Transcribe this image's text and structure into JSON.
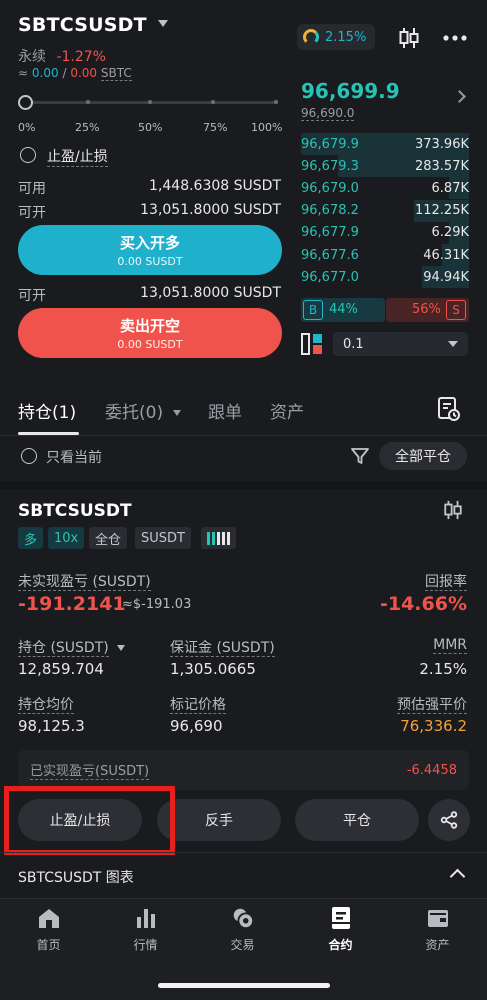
{
  "header": {
    "pair": "SBTCSUSDT",
    "contract_type": "永续",
    "change": "-1.27%",
    "available_prefix": "≈",
    "available_value": "0.00",
    "available_sep": "/",
    "available_value2": "0.00",
    "available_unit": "SBTC",
    "funding_rate": "2.15%"
  },
  "slider": {
    "labels": [
      "0%",
      "25%",
      "50%",
      "75%",
      "100%"
    ],
    "value_percent": 0
  },
  "order_form": {
    "tpsl_label": "止盈/止损",
    "available_label": "可用",
    "available_value": "1,448.6308 SUSDT",
    "open_label": "可开",
    "open_value": "13,051.8000 SUSDT",
    "buy_title": "买入开多",
    "buy_sub": "0.00 SUSDT",
    "open_label2": "可开",
    "open_value2": "13,051.8000 SUSDT",
    "sell_title": "卖出开空",
    "sell_sub": "0.00 SUSDT"
  },
  "orderbook": {
    "last_price": "96,699.9",
    "mark_price": "96,690.0",
    "bids": [
      {
        "price": "96,679.9",
        "size": "373.96K",
        "depth": 1.0
      },
      {
        "price": "96,679.3",
        "size": "283.57K",
        "depth": 0.78
      },
      {
        "price": "96,679.0",
        "size": "6.87K",
        "depth": 0.12
      },
      {
        "price": "96,678.2",
        "size": "112.25K",
        "depth": 0.33
      },
      {
        "price": "96,677.9",
        "size": "6.29K",
        "depth": 0.12
      },
      {
        "price": "96,677.6",
        "size": "46.31K",
        "depth": 0.16
      },
      {
        "price": "96,677.0",
        "size": "94.94K",
        "depth": 0.28
      }
    ],
    "buy_tag": "B",
    "buy_ratio": "44%",
    "sell_ratio": "56%",
    "sell_tag": "S",
    "depth_step": "0.1"
  },
  "tabs": [
    {
      "label": "持仓(1)"
    },
    {
      "label": "委托(0)"
    },
    {
      "label": "跟单"
    },
    {
      "label": "资产"
    }
  ],
  "filters": {
    "current_only": "只看当前",
    "close_all": "全部平仓"
  },
  "position": {
    "symbol": "SBTCSUSDT",
    "side": "多",
    "leverage": "10x",
    "margin_mode": "全仓",
    "settle": "SUSDT",
    "unrealized_label": "未实现盈亏 (SUSDT)",
    "unrealized_value": "-191.2141",
    "unrealized_usd": "≈$-191.03",
    "roi_label": "回报率",
    "roi_value": "-14.66%",
    "size_label": "持仓 (SUSDT)",
    "size_value": "12,859.704",
    "margin_label": "保证金 (SUSDT)",
    "margin_value": "1,305.0665",
    "mmr_label": "MMR",
    "mmr_value": "2.15%",
    "entry_label": "持仓均价",
    "entry_value": "98,125.3",
    "mark_label": "标记价格",
    "mark_value": "96,690",
    "liq_label": "预估强平价",
    "liq_value": "76,336.2",
    "realized_label": "已实现盈亏(SUSDT)",
    "realized_value": "-6.4458"
  },
  "actions": {
    "tpsl": "止盈/止损",
    "reverse": "反手",
    "close": "平仓"
  },
  "chart_row": {
    "label": "SBTCSUSDT 图表"
  },
  "nav": [
    {
      "label": "首页"
    },
    {
      "label": "行情"
    },
    {
      "label": "交易"
    },
    {
      "label": "合约"
    },
    {
      "label": "资产"
    }
  ]
}
